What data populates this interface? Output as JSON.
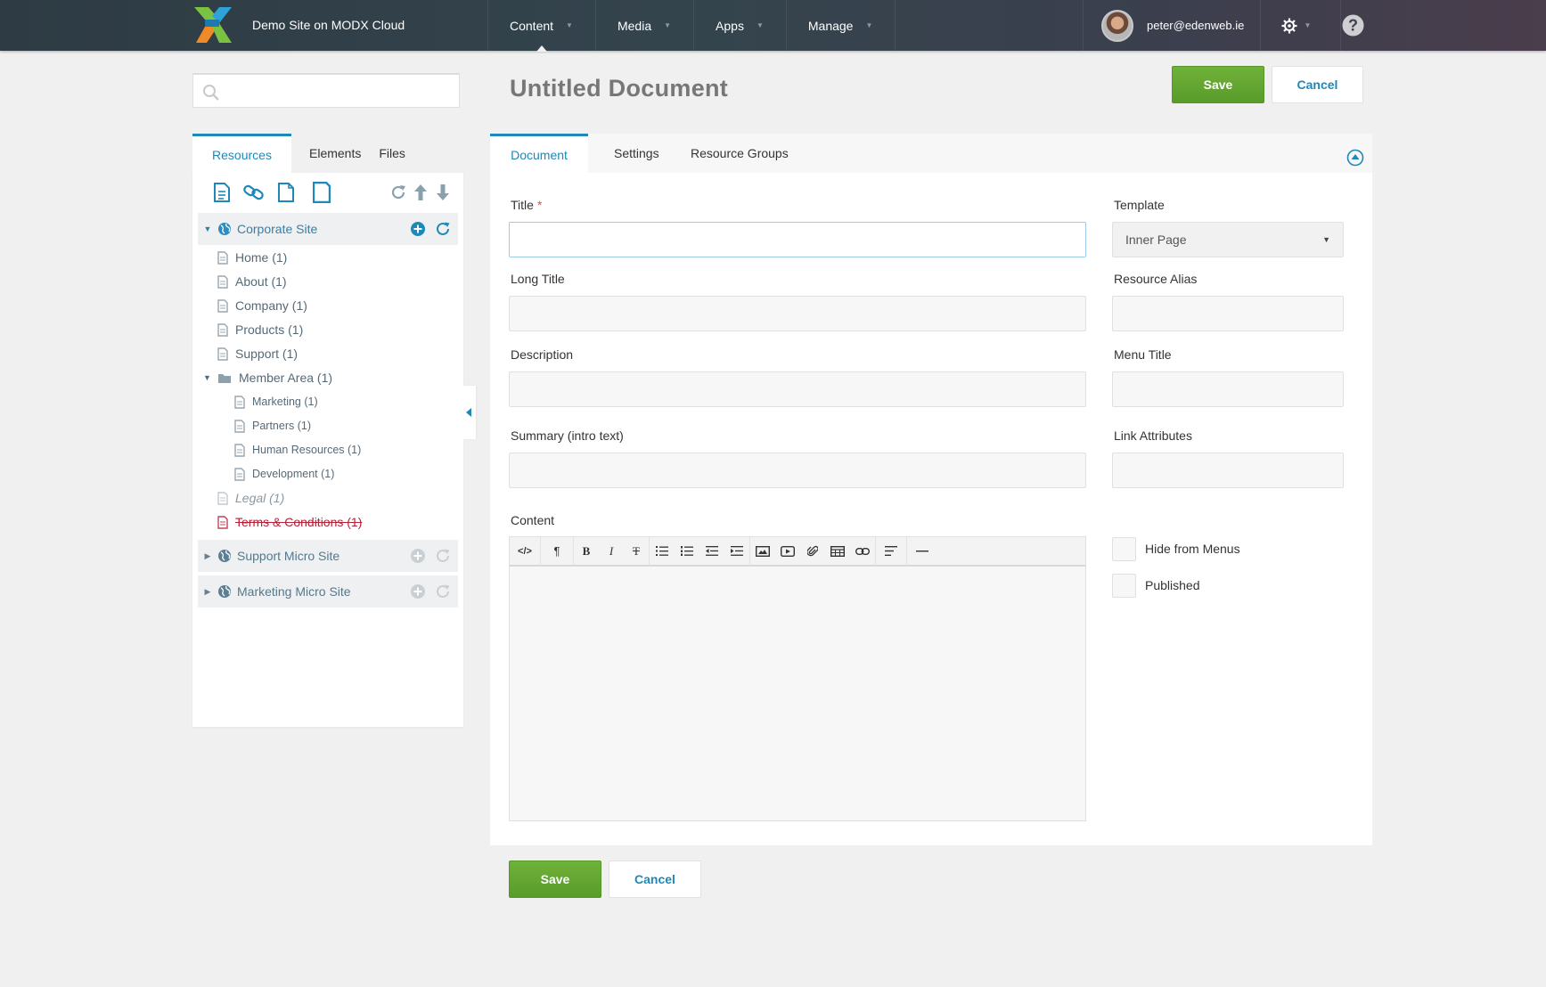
{
  "header": {
    "site_name": "Demo Site on MODX Cloud",
    "nav": [
      {
        "label": "Content"
      },
      {
        "label": "Media"
      },
      {
        "label": "Apps"
      },
      {
        "label": "Manage"
      }
    ],
    "user_email": "peter@edenweb.ie",
    "help_glyph": "?"
  },
  "sidebar": {
    "search_placeholder": "",
    "tabs": [
      {
        "label": "Resources"
      },
      {
        "label": "Elements"
      },
      {
        "label": "Files"
      }
    ],
    "contexts": [
      {
        "label": "Corporate Site",
        "items": [
          {
            "label": "Home (1)"
          },
          {
            "label": "About (1)"
          },
          {
            "label": "Company (1)"
          },
          {
            "label": "Products (1)"
          },
          {
            "label": "Support (1)"
          },
          {
            "label": "Member Area (1)",
            "children": [
              {
                "label": "Marketing (1)"
              },
              {
                "label": "Partners (1)"
              },
              {
                "label": "Human Resources (1)"
              },
              {
                "label": "Development (1)"
              }
            ]
          },
          {
            "label": "Legal (1)"
          },
          {
            "label": "Terms & Conditions (1)"
          }
        ]
      },
      {
        "label": "Support Micro Site"
      },
      {
        "label": "Marketing Micro Site"
      }
    ]
  },
  "page": {
    "title": "Untitled Document",
    "save_label": "Save",
    "cancel_label": "Cancel"
  },
  "main_tabs": [
    {
      "label": "Document"
    },
    {
      "label": "Settings"
    },
    {
      "label": "Resource Groups"
    }
  ],
  "form": {
    "title_label": "Title",
    "required_mark": "*",
    "title_value": "",
    "long_title_label": "Long Title",
    "description_label": "Description",
    "summary_label": "Summary (intro text)",
    "content_label": "Content",
    "template_label": "Template",
    "template_value": "Inner Page",
    "alias_label": "Resource Alias",
    "menu_title_label": "Menu Title",
    "link_attributes_label": "Link Attributes",
    "hide_from_menus_label": "Hide from Menus",
    "hide_from_menus_checked": false,
    "published_label": "Published",
    "published_checked": false
  },
  "editor_toolbar": [
    "code",
    "paragraph",
    "bold",
    "italic",
    "strikethrough",
    "bullet-list",
    "numbered-list",
    "outdent",
    "indent",
    "image",
    "video",
    "attachment",
    "table",
    "link",
    "align",
    "horizontal-rule"
  ],
  "colors": {
    "accent": "#1e88b8",
    "save_green": "#64a832",
    "deleted_red": "#b5223a"
  }
}
